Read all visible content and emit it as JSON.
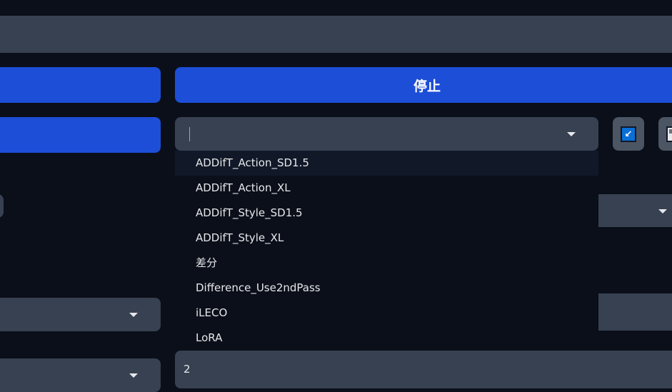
{
  "buttons": {
    "stop_label": "停止"
  },
  "dropdown": {
    "value": "",
    "options": [
      "ADDifT_Action_SD1.5",
      "ADDifT_Action_XL",
      "ADDifT_Style_SD1.5",
      "ADDifT_Style_XL",
      "差分",
      "Difference_Use2ndPass",
      "iLECO",
      "LoRA"
    ],
    "highlighted_index": 0
  },
  "icons": {
    "apply": "arrow-down-left-icon",
    "save": "save-icon"
  },
  "number_field": {
    "value": "2"
  },
  "colors": {
    "background": "#0b0f19",
    "panel": "#374151",
    "primary": "#1d4ed8"
  }
}
